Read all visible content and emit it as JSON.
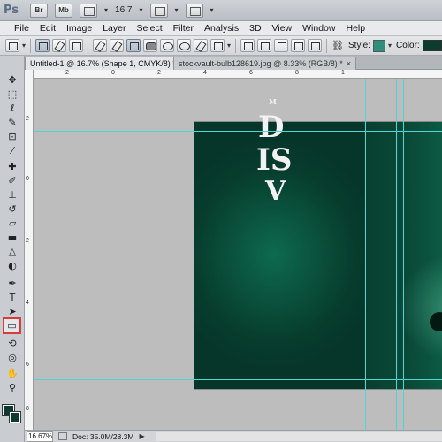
{
  "app": {
    "logo_text": "Ps",
    "bridge_label": "Br",
    "minibridge_label": "Mb",
    "zoom_value": "16.7",
    "dropdown_glyph": "▾"
  },
  "menu": [
    "File",
    "Edit",
    "Image",
    "Layer",
    "Select",
    "Filter",
    "Analysis",
    "3D",
    "View",
    "Window",
    "Help"
  ],
  "options_bar": {
    "style_label": "Style:",
    "color_label": "Color:",
    "style_color": "#2f8f7d",
    "fill_color": "#0b3d2e"
  },
  "tabs": [
    {
      "label": "Untitled-1 @ 16.7% (Shape 1, CMYK/8) *",
      "close": "×"
    },
    {
      "label": "stockvault-bulb128619.jpg @ 8.33% (RGB/8) *",
      "close": "×"
    }
  ],
  "rulers": {
    "top_ticks": [
      "2",
      "0",
      "2",
      "4",
      "6",
      "8",
      "1"
    ],
    "left_ticks": [
      "2",
      "0",
      "2",
      "4",
      "6",
      "8"
    ]
  },
  "document": {
    "line1": "M",
    "line2": "D",
    "line3": "IS",
    "line4": "V"
  },
  "tools": [
    {
      "name": "move-tool",
      "glyph": "✥"
    },
    {
      "name": "marquee-tool",
      "glyph": "⬚"
    },
    {
      "name": "lasso-tool",
      "glyph": "ℓ"
    },
    {
      "name": "quick-select-tool",
      "glyph": "✎"
    },
    {
      "name": "crop-tool",
      "glyph": "⊡"
    },
    {
      "name": "eyedropper-tool",
      "glyph": "⁄"
    },
    {
      "name": "healing-brush-tool",
      "glyph": "✚"
    },
    {
      "name": "brush-tool",
      "glyph": "✐"
    },
    {
      "name": "clone-stamp-tool",
      "glyph": "⊥"
    },
    {
      "name": "history-brush-tool",
      "glyph": "↺"
    },
    {
      "name": "eraser-tool",
      "glyph": "▱"
    },
    {
      "name": "gradient-tool",
      "glyph": "▬"
    },
    {
      "name": "blur-tool",
      "glyph": "△"
    },
    {
      "name": "dodge-tool",
      "glyph": "◐"
    },
    {
      "name": "pen-tool",
      "glyph": "✒"
    },
    {
      "name": "type-tool",
      "glyph": "T"
    },
    {
      "name": "path-selection-tool",
      "glyph": "➤"
    },
    {
      "name": "rectangle-tool",
      "glyph": "▭"
    },
    {
      "name": "3d-rotate-tool",
      "glyph": "⟲"
    },
    {
      "name": "3d-orbit-tool",
      "glyph": "◎"
    },
    {
      "name": "hand-tool",
      "glyph": "✋"
    },
    {
      "name": "zoom-tool",
      "glyph": "⚲"
    }
  ],
  "status": {
    "zoom": "16.67%",
    "doc_info": "Doc: 35.0M/28.3M",
    "arrow": "▶"
  }
}
